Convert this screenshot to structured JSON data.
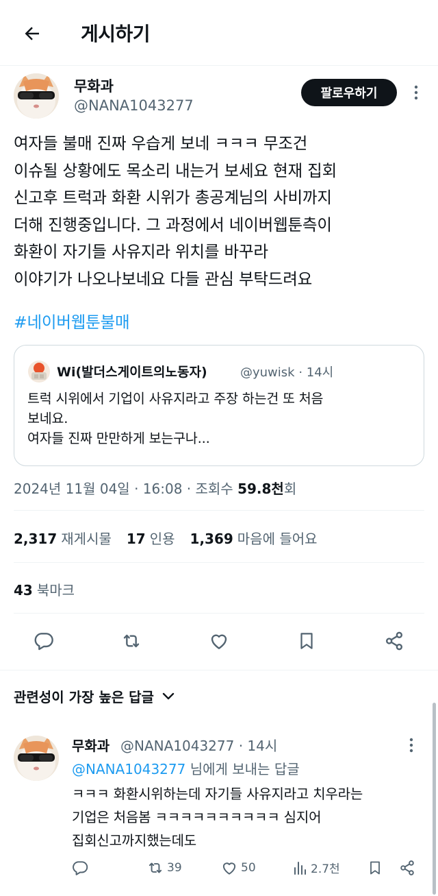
{
  "header": {
    "title": "게시하기",
    "back_icon": "arrow-left-icon"
  },
  "post": {
    "author": {
      "name": "무화과",
      "handle": "@NANA1043277",
      "avatar": "cat-with-sunglasses-avatar"
    },
    "follow_label": "팔로우하기",
    "text": "여자들 불매 진짜 우습게 보네 ㅋㅋㅋ 무조건\n이슈될 상황에도 목소리 내는거 보세요 현재 집회\n신고후 트럭과 화환 시위가 총공계님의 사비까지\n더해 진행중입니다. 그 과정에서 네이버웹툰측이\n화환이 자기들 사유지라 위치를 바꾸라\n이야기가 나오나보네요 다들 관심 부탁드려요",
    "hashtag": "#네이버웹툰불매",
    "quote": {
      "name": "Wi(발더스게이트의노동자)",
      "handle": "@yuwisk",
      "time": "· 14시",
      "text": "트럭 시위에서 기업이 사유지라고 주장 하는건 또 처음\n보네요.\n여자들 진짜 만만하게 보는구나..."
    },
    "timestamp": {
      "date": "2024년 11월 04일 · 16:08 · 조회수 ",
      "views": "59.8천",
      "suffix": "회"
    },
    "stats": {
      "reposts_num": "2,317",
      "reposts_label": "재게시물",
      "quotes_num": "17",
      "quotes_label": "인용",
      "likes_num": "1,369",
      "likes_label": "마음에 들어요",
      "bookmarks_num": "43",
      "bookmarks_label": "북마크"
    }
  },
  "replies_sort_label": "관련성이 가장 높은 답글",
  "reply": {
    "name": "무화과",
    "handle_time": "@NANA1043277 · 14시",
    "reply_to_mention": "@NANA1043277",
    "reply_to_suffix": " 님에게 보내는 답글",
    "text": "ㅋㅋㅋ 화환시위하는데 자기들 사유지라고 치우라는\n기업은 처음봄 ㅋㅋㅋㅋㅋㅋㅋㅋㅋㅋ 심지어\n집회신고까지했는데도",
    "retweets": "39",
    "likes": "50",
    "views": "2.7천"
  },
  "colors": {
    "accent": "#1d9bf0",
    "text": "#0f1419",
    "muted": "#536471",
    "border": "#cfd9de"
  }
}
